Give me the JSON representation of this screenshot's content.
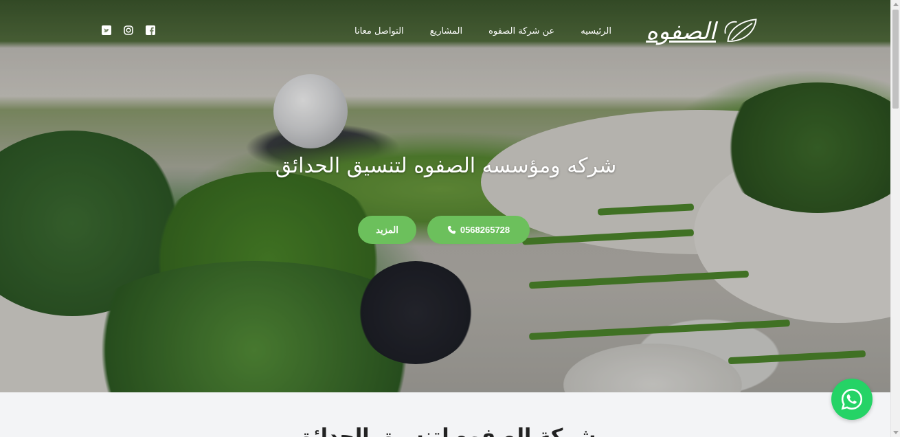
{
  "brand": {
    "logo_text": "الصفوه"
  },
  "nav": {
    "items": [
      {
        "label": "الرئيسيه"
      },
      {
        "label": "عن شركة الصفوه"
      },
      {
        "label": "المشاريع"
      },
      {
        "label": "التواصل معانا"
      }
    ],
    "socials": [
      "facebook-icon",
      "instagram-icon",
      "twitter-icon"
    ]
  },
  "hero": {
    "title": "شركه ومؤسسه الصفوه لتنسيق الحدائق",
    "phone_button": "0568265728",
    "more_button": "المزيد"
  },
  "section": {
    "heading": "شركة الصفوه لتنسيق الحدائق"
  },
  "colors": {
    "accent": "#6cc05c",
    "whatsapp": "#25d366"
  }
}
